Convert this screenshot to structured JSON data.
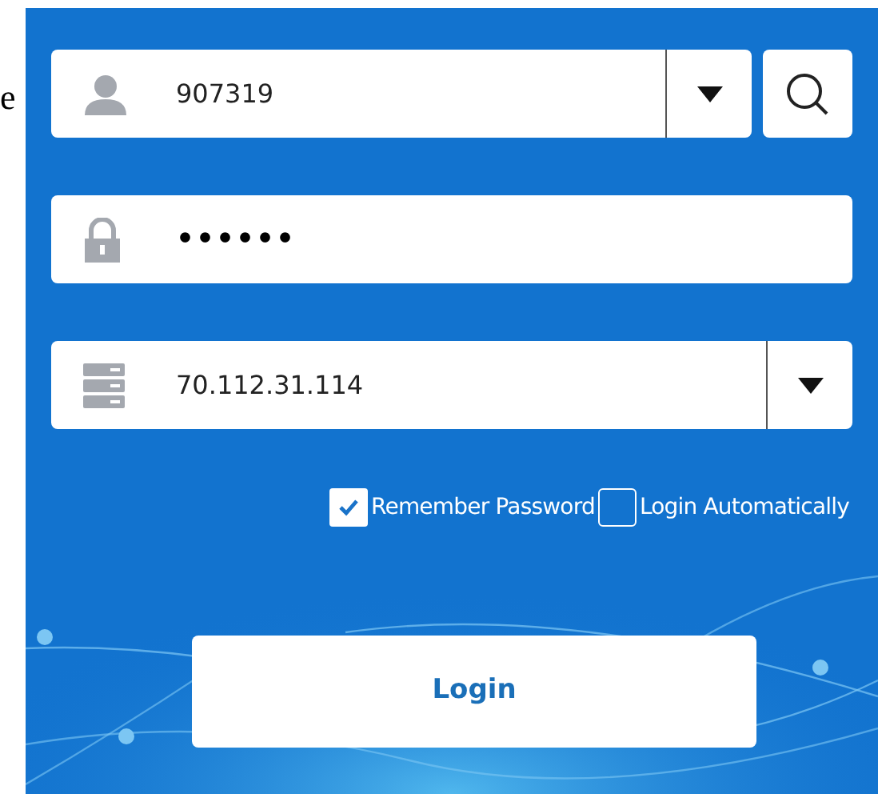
{
  "side_text": "e",
  "username": {
    "value": "907319"
  },
  "password": {
    "value": "••••••"
  },
  "server": {
    "value": "70.112.31.114"
  },
  "options": [
    {
      "label": "Remember Password",
      "checked": true
    },
    {
      "label": "Login Automatically",
      "checked": false
    }
  ],
  "login_button": "Login"
}
